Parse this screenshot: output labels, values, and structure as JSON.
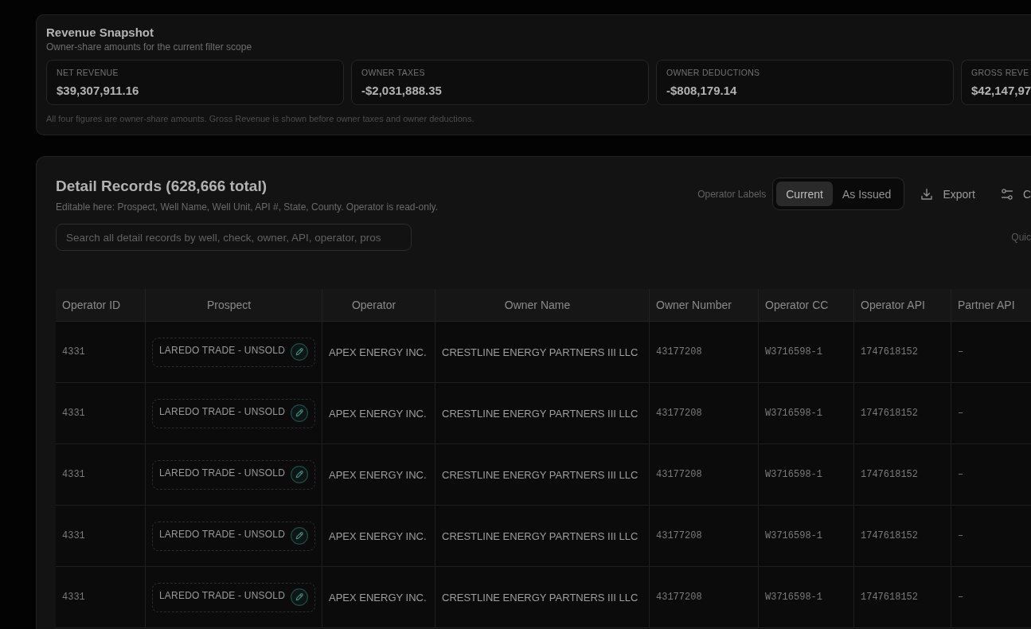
{
  "revenue_snapshot": {
    "title": "Revenue Snapshot",
    "subtitle": "Owner-share amounts for the current filter scope",
    "cards": [
      {
        "label": "NET REVENUE",
        "value": "$39,307,911.16"
      },
      {
        "label": "OWNER TAXES",
        "value": "-$2,031,888.35"
      },
      {
        "label": "OWNER DEDUCTIONS",
        "value": "-$808,179.14"
      },
      {
        "label": "GROSS REVE",
        "value": "$42,147,97"
      }
    ],
    "footnote": "All four figures are owner-share amounts. Gross Revenue is shown before owner taxes and owner deductions."
  },
  "detail_records": {
    "title": "Detail Records (628,666 total)",
    "subtitle": "Editable here: Prospect, Well Name, Well Unit, API #, State, County. Operator is read-only.",
    "operator_labels": {
      "label": "Operator Labels",
      "options": [
        {
          "label": "Current",
          "selected": true
        },
        {
          "label": "As Issued",
          "selected": false
        }
      ]
    },
    "export_button": "Export",
    "columns_button": "C",
    "search": {
      "placeholder": "Search all detail records by well, check, owner, API, operator, pros"
    },
    "quick_label": "Quic",
    "table": {
      "columns": [
        {
          "label": "Operator ID",
          "kind": "mono"
        },
        {
          "label": "Prospect",
          "kind": "chip"
        },
        {
          "label": "Operator",
          "kind": "text"
        },
        {
          "label": "Owner Name",
          "kind": "text"
        },
        {
          "label": "Owner Number",
          "kind": "mono"
        },
        {
          "label": "Operator CC",
          "kind": "mono"
        },
        {
          "label": "Operator API",
          "kind": "mono"
        },
        {
          "label": "Partner API",
          "kind": "mono"
        }
      ],
      "rows": [
        {
          "cells": [
            "4331",
            "LAREDO TRADE - UNSOLD",
            "APEX ENERGY INC.",
            "CRESTLINE ENERGY PARTNERS III LLC",
            "43177208",
            "W3716598-1",
            "1747618152",
            "–"
          ]
        },
        {
          "cells": [
            "4331",
            "LAREDO TRADE - UNSOLD",
            "APEX ENERGY INC.",
            "CRESTLINE ENERGY PARTNERS III LLC",
            "43177208",
            "W3716598-1",
            "1747618152",
            "–"
          ]
        },
        {
          "cells": [
            "4331",
            "LAREDO TRADE - UNSOLD",
            "APEX ENERGY INC.",
            "CRESTLINE ENERGY PARTNERS III LLC",
            "43177208",
            "W3716598-1",
            "1747618152",
            "–"
          ]
        },
        {
          "cells": [
            "4331",
            "LAREDO TRADE - UNSOLD",
            "APEX ENERGY INC.",
            "CRESTLINE ENERGY PARTNERS III LLC",
            "43177208",
            "W3716598-1",
            "1747618152",
            "–"
          ]
        },
        {
          "cells": [
            "4331",
            "LAREDO TRADE - UNSOLD",
            "APEX ENERGY INC.",
            "CRESTLINE ENERGY PARTNERS III LLC",
            "43177208",
            "W3716598-1",
            "1747618152",
            "–"
          ]
        }
      ]
    }
  }
}
